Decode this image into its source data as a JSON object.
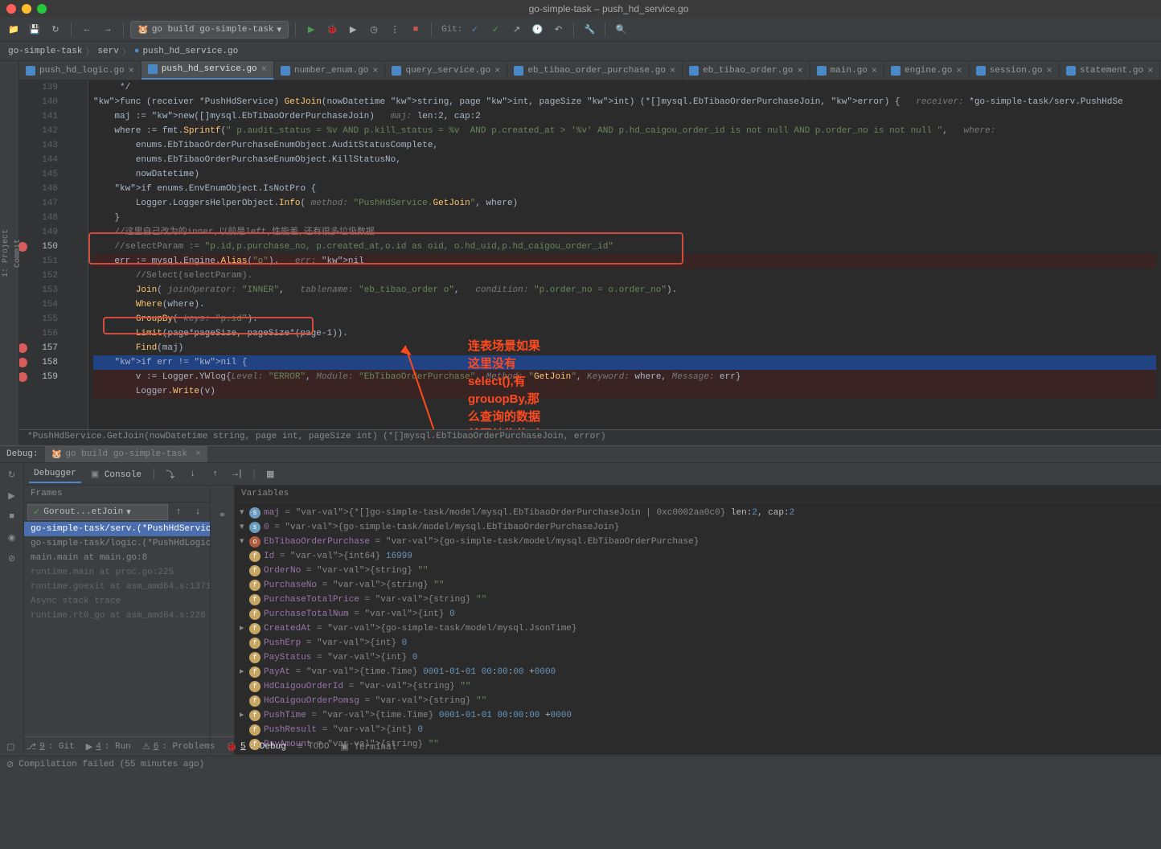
{
  "title": "go-simple-task – push_hd_service.go",
  "run_config": "go build go-simple-task",
  "breadcrumbs": [
    "go-simple-task",
    "serv",
    "push_hd_service.go"
  ],
  "tabs": [
    {
      "label": "push_hd_logic.go",
      "active": false
    },
    {
      "label": "push_hd_service.go",
      "active": true
    },
    {
      "label": "number_enum.go",
      "active": false
    },
    {
      "label": "query_service.go",
      "active": false
    },
    {
      "label": "eb_tibao_order_purchase.go",
      "active": false
    },
    {
      "label": "eb_tibao_order.go",
      "active": false
    },
    {
      "label": "main.go",
      "active": false
    },
    {
      "label": "engine.go",
      "active": false
    },
    {
      "label": "session.go",
      "active": false
    },
    {
      "label": "statement.go",
      "active": false
    }
  ],
  "left_gutter": [
    "1: Project",
    "Commit"
  ],
  "right_gutter": [],
  "lines": [
    {
      "n": "",
      "cls": "",
      "content": "     */"
    },
    {
      "n": "139",
      "cls": "",
      "content": "func (receiver *PushHdService) GetJoin(nowDatetime string, page int, pageSize int) (*[]mysql.EbTibaoOrderPurchaseJoin, error) {   receiver: *go-simple-task/serv.PushHdSe"
    },
    {
      "n": "140",
      "cls": "",
      "content": "    maj := new([]mysql.EbTibaoOrderPurchaseJoin)   maj: len:2, cap:2"
    },
    {
      "n": "141",
      "cls": "",
      "content": "    where := fmt.Sprintf(\" p.audit_status = %v AND p.kill_status = %v  AND p.created_at > '%v' AND p.hd_caigou_order_id is not null AND p.order_no is not null \",   where:"
    },
    {
      "n": "142",
      "cls": "",
      "content": "        enums.EbTibaoOrderPurchaseEnumObject.AuditStatusComplete,"
    },
    {
      "n": "143",
      "cls": "",
      "content": "        enums.EbTibaoOrderPurchaseEnumObject.KillStatusNo,"
    },
    {
      "n": "144",
      "cls": "",
      "content": "        nowDatetime)"
    },
    {
      "n": "145",
      "cls": "",
      "content": "    if enums.EnvEnumObject.IsNotPro {"
    },
    {
      "n": "146",
      "cls": "",
      "content": "        Logger.LoggersHelperObject.Info( method: \"PushHdService.GetJoin\", where)"
    },
    {
      "n": "147",
      "cls": "",
      "content": "    }"
    },
    {
      "n": "148",
      "cls": "",
      "content": "    //这里自己改为的inner,以前是left,性能差,还有很多垃圾数据"
    },
    {
      "n": "149",
      "cls": "",
      "content": "    //selectParam := \"p.id,p.purchase_no, p.created_at,o.id as oid, o.hd_uid,p.hd_caigou_order_id\""
    },
    {
      "n": "150",
      "cls": "bp",
      "content": "    err := mysql.Engine.Alias(\"p\").   err: nil"
    },
    {
      "n": "151",
      "cls": "",
      "content": "        //Select(selectParam)."
    },
    {
      "n": "152",
      "cls": "",
      "content": "        Join( joinOperator: \"INNER\",   tablename: \"eb_tibao_order o\",   condition: \"p.order_no = o.order_no\")."
    },
    {
      "n": "153",
      "cls": "",
      "content": "        Where(where)."
    },
    {
      "n": "154",
      "cls": "",
      "content": "        GroupBy( keys: \"p.id\")."
    },
    {
      "n": "155",
      "cls": "",
      "content": "        Limit(page*pageSize, pageSize*(page-1))."
    },
    {
      "n": "156",
      "cls": "",
      "content": "        Find(maj)"
    },
    {
      "n": "157",
      "cls": "sel bp",
      "content": "    if err != nil {"
    },
    {
      "n": "158",
      "cls": "bp",
      "content": "        v := Logger.YWlog{Level: \"ERROR\", Module: \"EbTibaoOrderPurchase\", Method: \"GetJoin\", Keyword: where, Message: err}"
    },
    {
      "n": "159",
      "cls": "bp",
      "content": "        Logger.Write(v)"
    }
  ],
  "crumb_trail": "*PushHdService.GetJoin(nowDatetime string, page int, pageSize int) (*[]mysql.EbTibaoOrderPurchaseJoin, error)",
  "annotation": "连表场景如果\n这里没有\nselect(),有\ngrouopBy,那\n么查询的数据\n就跟结构体对\n应不上，如果\n没groupBy,\n也没有\nselect，是会\n对应上的",
  "debug": {
    "title": "Debug:",
    "run_tab": "go build go-simple-task",
    "tabs": [
      "Debugger",
      "Console"
    ],
    "frames_title": "Frames",
    "gorout": "Gorout...etJoin",
    "frames": [
      {
        "label": "go-simple-task/serv.(*PushHdService",
        "sel": true
      },
      {
        "label": "go-simple-task/logic.(*PushHdLogic)",
        "sel": false
      },
      {
        "label": "main.main at main.go:8",
        "sel": false
      },
      {
        "label": "runtime.main at proc.go:225",
        "sel": false,
        "dim": true
      },
      {
        "label": "runtime.goexit at asm_amd64.s:1371",
        "sel": false,
        "dim": true
      },
      {
        "label": "Async stack trace",
        "sel": false,
        "dim": true,
        "header": true
      },
      {
        "label": "runtime.rt0_go at asm_amd64.s:226",
        "sel": false,
        "dim": true
      }
    ],
    "vars_title": "Variables",
    "vars": [
      {
        "indent": 0,
        "twisty": "v",
        "icon": "s",
        "name": "maj",
        "val": "= {*[]go-simple-task/model/mysql.EbTibaoOrderPurchaseJoin | 0xc0002aa0c0} len:2, cap:2"
      },
      {
        "indent": 1,
        "twisty": "v",
        "icon": "s",
        "name": "0",
        "val": "= {go-simple-task/model/mysql.EbTibaoOrderPurchaseJoin}"
      },
      {
        "indent": 2,
        "twisty": "v",
        "icon": "o",
        "name": "EbTibaoOrderPurchase",
        "val": "= {go-simple-task/model/mysql.EbTibaoOrderPurchase}"
      },
      {
        "indent": 3,
        "twisty": " ",
        "icon": "f",
        "name": "Id",
        "val": "= {int64} 16999"
      },
      {
        "indent": 3,
        "twisty": " ",
        "icon": "f",
        "name": "OrderNo",
        "val": "= {string} \"\""
      },
      {
        "indent": 3,
        "twisty": " ",
        "icon": "f",
        "name": "PurchaseNo",
        "val": "= {string} \"\""
      },
      {
        "indent": 3,
        "twisty": " ",
        "icon": "f",
        "name": "PurchaseTotalPrice",
        "val": "= {string} \"\""
      },
      {
        "indent": 3,
        "twisty": " ",
        "icon": "f",
        "name": "PurchaseTotalNum",
        "val": "= {int} 0"
      },
      {
        "indent": 3,
        "twisty": ">",
        "icon": "f",
        "name": "CreatedAt",
        "val": "= {go-simple-task/model/mysql.JsonTime}"
      },
      {
        "indent": 3,
        "twisty": " ",
        "icon": "f",
        "name": "PushErp",
        "val": "= {int} 0"
      },
      {
        "indent": 3,
        "twisty": " ",
        "icon": "f",
        "name": "PayStatus",
        "val": "= {int} 0"
      },
      {
        "indent": 3,
        "twisty": ">",
        "icon": "f",
        "name": "PayAt",
        "val": "= {time.Time} 0001-01-01 00:00:00 +0000"
      },
      {
        "indent": 3,
        "twisty": " ",
        "icon": "f",
        "name": "HdCaigouOrderId",
        "val": "= {string} \"\""
      },
      {
        "indent": 3,
        "twisty": " ",
        "icon": "f",
        "name": "HdCaigouOrderPomsg",
        "val": "= {string} \"\""
      },
      {
        "indent": 3,
        "twisty": ">",
        "icon": "f",
        "name": "PushTime",
        "val": "= {time.Time} 0001-01-01 00:00:00 +0000"
      },
      {
        "indent": 3,
        "twisty": " ",
        "icon": "f",
        "name": "PushResult",
        "val": "= {int} 0"
      },
      {
        "indent": 3,
        "twisty": " ",
        "icon": "f",
        "name": "PayAmount",
        "val": "= {string} \"\""
      }
    ]
  },
  "btm_tools": [
    {
      "label": "9: Git",
      "u": "9"
    },
    {
      "label": "4: Run",
      "u": "4"
    },
    {
      "label": "6: Problems",
      "u": "6"
    },
    {
      "label": "5: Debug",
      "u": "5",
      "active": true
    },
    {
      "label": "TODO"
    },
    {
      "label": "Terminal"
    }
  ],
  "status": "Compilation failed (55 minutes ago)"
}
